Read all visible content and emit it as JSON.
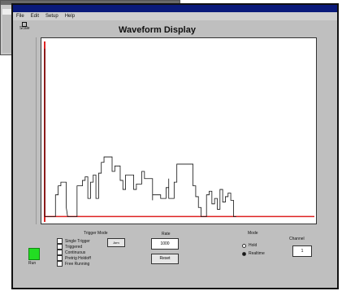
{
  "background_window": {
    "strip_text": ""
  },
  "window": {
    "title": "",
    "menu": [
      "File",
      "Edit",
      "Setup",
      "Help"
    ]
  },
  "display": {
    "title": "Waveform Display",
    "scale_label": "Scale",
    "axis_top_label": "",
    "axis_bottom_label": "",
    "x_start_label": "",
    "x_end_label": ""
  },
  "controls": {
    "run_label": "Run",
    "trigger_title": "Trigger Mode",
    "trigger_options": [
      "Single Trigger",
      "Triggered",
      "Continuous",
      "Pretrig Holdoff",
      "Free Running"
    ],
    "trigger_button": "Arm",
    "rate_label": "Rate",
    "rate_value": "1000",
    "reset_button": "Reset",
    "mode_label": "Mode",
    "mode_options": [
      "Hold",
      "Realtime"
    ],
    "mode_selected": 1,
    "channel_label": "Channel",
    "channel_value": "1"
  },
  "colors": {
    "trace": "#111111",
    "cursor": "#dd2222",
    "run": "#22dd22",
    "titlebar": "#0a1a7a"
  },
  "waveform": {
    "x_range": [
      0,
      100
    ],
    "y_range": [
      0,
      100
    ],
    "points": [
      [
        0,
        96
      ],
      [
        0,
        3
      ],
      [
        1,
        3
      ],
      [
        2,
        3
      ],
      [
        3,
        3
      ],
      [
        4,
        3
      ],
      [
        4,
        15
      ],
      [
        5,
        15
      ],
      [
        5,
        20
      ],
      [
        6,
        20
      ],
      [
        6,
        22
      ],
      [
        8,
        22
      ],
      [
        8,
        8
      ],
      [
        8.5,
        3
      ],
      [
        12,
        3
      ],
      [
        12,
        20
      ],
      [
        14,
        20
      ],
      [
        14,
        23
      ],
      [
        15,
        23
      ],
      [
        15,
        25
      ],
      [
        16,
        25
      ],
      [
        16,
        13
      ],
      [
        17,
        13
      ],
      [
        17,
        22
      ],
      [
        18,
        22
      ],
      [
        18,
        26
      ],
      [
        19,
        26
      ],
      [
        19,
        13
      ],
      [
        20,
        13
      ],
      [
        20,
        27
      ],
      [
        21,
        27
      ],
      [
        21,
        33
      ],
      [
        22,
        33
      ],
      [
        22,
        36
      ],
      [
        25,
        36
      ],
      [
        25,
        28
      ],
      [
        26,
        28
      ],
      [
        26,
        31
      ],
      [
        28,
        31
      ],
      [
        28,
        23
      ],
      [
        29,
        23
      ],
      [
        29,
        18
      ],
      [
        30,
        18
      ],
      [
        30,
        26
      ],
      [
        33,
        26
      ],
      [
        33,
        18
      ],
      [
        34,
        18
      ],
      [
        34,
        21
      ],
      [
        36,
        21
      ],
      [
        36,
        28
      ],
      [
        37,
        28
      ],
      [
        37,
        24
      ],
      [
        40,
        24
      ],
      [
        40,
        12
      ],
      [
        40,
        15
      ],
      [
        43,
        15
      ],
      [
        43,
        13
      ],
      [
        45,
        13
      ],
      [
        45,
        19
      ],
      [
        46,
        19
      ],
      [
        46,
        24
      ],
      [
        46,
        13
      ],
      [
        48,
        13
      ],
      [
        48,
        22
      ],
      [
        49,
        22
      ],
      [
        49,
        32
      ],
      [
        55,
        32
      ],
      [
        55,
        20
      ],
      [
        56,
        20
      ],
      [
        56,
        14
      ],
      [
        57,
        14
      ],
      [
        57,
        8
      ],
      [
        58,
        8
      ],
      [
        58,
        3
      ],
      [
        60,
        3
      ],
      [
        60,
        15
      ],
      [
        61,
        15
      ],
      [
        61,
        17
      ],
      [
        62,
        17
      ],
      [
        62,
        10
      ],
      [
        63,
        10
      ],
      [
        63,
        13
      ],
      [
        64,
        13
      ],
      [
        64,
        7
      ],
      [
        65,
        7
      ],
      [
        65,
        18
      ],
      [
        66,
        18
      ],
      [
        66,
        11
      ],
      [
        67,
        11
      ],
      [
        67,
        14
      ],
      [
        68,
        14
      ],
      [
        68,
        16
      ],
      [
        69,
        16
      ],
      [
        69,
        12
      ],
      [
        70,
        12
      ],
      [
        70,
        3
      ],
      [
        71,
        3
      ]
    ],
    "cursor_x": 0,
    "baseline_y": 3
  }
}
